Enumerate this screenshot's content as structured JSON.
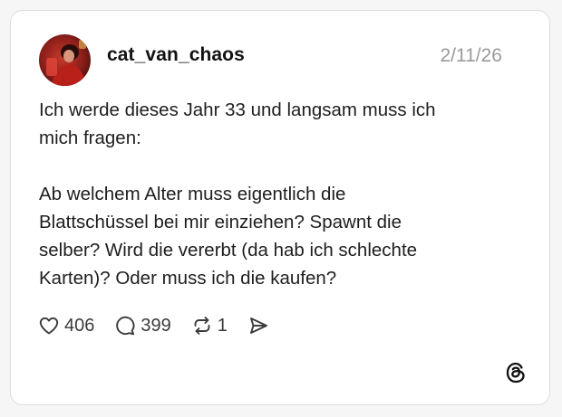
{
  "post": {
    "username": "cat_van_chaos",
    "date": "2/11/26",
    "text": "Ich werde dieses Jahr 33 und langsam muss ich\nmich fragen:\n\nAb welchem Alter muss eigentlich die\nBlattschüssel bei mir einziehen? Spawnt die\nselber? Wird die vererbt (da hab ich schlechte\nKarten)? Oder muss ich die kaufen?"
  },
  "actions": {
    "likes": "406",
    "replies": "399",
    "reposts": "1"
  },
  "icons": {
    "like": "heart-icon",
    "reply": "speech-bubble-icon",
    "repost": "repost-icon",
    "share": "send-icon",
    "brand": "threads-logo-icon"
  },
  "colors": {
    "card_background": "#ffffff",
    "page_background": "#f6f6f6",
    "muted_text": "#9a9a9a"
  }
}
